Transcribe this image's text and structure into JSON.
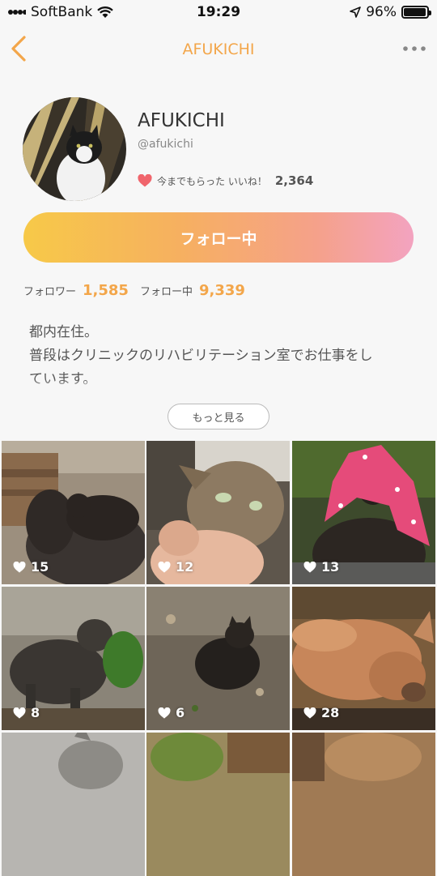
{
  "status_bar": {
    "carrier": "SoftBank",
    "time": "19:29",
    "battery": "96%",
    "battery_level": 0.96
  },
  "nav": {
    "title": "AFUKICHI",
    "back_icon": "chevron-left-icon",
    "more_icon": "more-dots-icon"
  },
  "profile": {
    "name": "AFUKICHI",
    "handle": "@afukichi",
    "likes_label": "今までもらった いいね！",
    "likes_count": "2,364",
    "follow_button": "フォロー中",
    "followers_label": "フォロワー",
    "followers_count": "1,585",
    "following_label": "フォロー中",
    "following_count": "9,339",
    "bio_line1": "都内在住。",
    "bio_line2": "普段はクリニックのリハビリテーション室でお仕事をし",
    "bio_line3": "ています。",
    "more_button": "もっと見る"
  },
  "photos": [
    {
      "likes": "15"
    },
    {
      "likes": "12"
    },
    {
      "likes": "13"
    },
    {
      "likes": "8"
    },
    {
      "likes": "6"
    },
    {
      "likes": "28"
    },
    {
      "likes": ""
    },
    {
      "likes": ""
    },
    {
      "likes": ""
    }
  ],
  "colors": {
    "accent": "#f3a64a",
    "gradient_start": "#f7c948",
    "gradient_end": "#f3a3c0",
    "heart": "#f0656c"
  }
}
